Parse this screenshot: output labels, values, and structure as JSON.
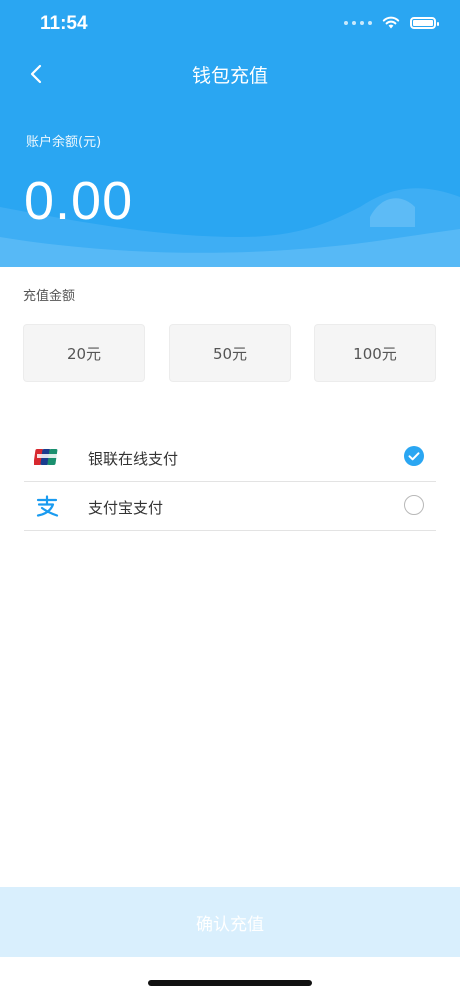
{
  "status_bar": {
    "time": "11:54"
  },
  "nav": {
    "title": "钱包充值",
    "back_icon": "chevron-left-icon"
  },
  "balance": {
    "label": "账户余额(元)",
    "value": "0.00"
  },
  "amount_section": {
    "label": "充值金额",
    "options": [
      {
        "label": "20元"
      },
      {
        "label": "50元"
      },
      {
        "label": "100元"
      }
    ]
  },
  "payment_methods": [
    {
      "label": "银联在线支付",
      "icon": "unionpay-icon",
      "selected": true
    },
    {
      "label": "支付宝支付",
      "icon": "alipay-icon",
      "selected": false
    }
  ],
  "confirm": {
    "label": "确认充值"
  },
  "colors": {
    "primary": "#2aa6f2",
    "confirm_disabled": "#d9effd",
    "option_bg": "#f5f5f5",
    "text_dark": "#333333"
  }
}
